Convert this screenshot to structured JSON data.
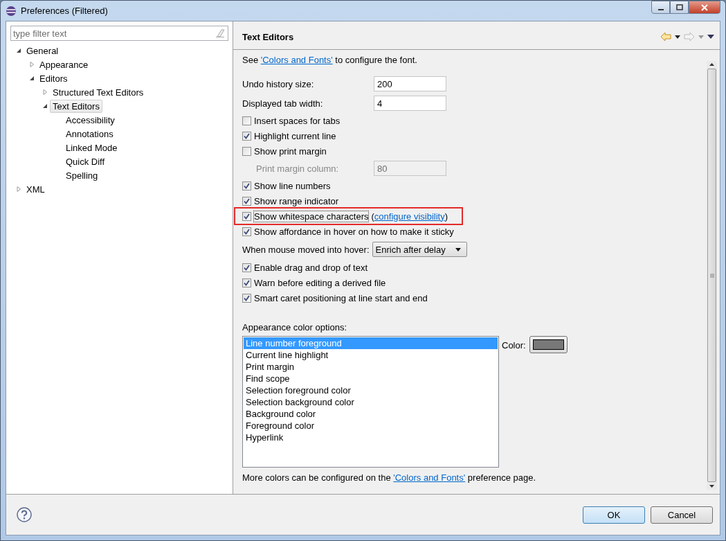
{
  "window": {
    "title": "Preferences (Filtered)"
  },
  "sidebar": {
    "filter": {
      "placeholder": "type filter text"
    },
    "tree": [
      {
        "label": "General",
        "expanded": true,
        "selected": false,
        "children": [
          {
            "label": "Appearance",
            "expanded": false,
            "selected": false,
            "has_children": true
          },
          {
            "label": "Editors",
            "expanded": true,
            "selected": false,
            "children": [
              {
                "label": "Structured Text Editors",
                "expanded": false,
                "selected": false,
                "has_children": true
              },
              {
                "label": "Text Editors",
                "expanded": true,
                "selected": true,
                "children": [
                  {
                    "label": "Accessibility",
                    "selected": false
                  },
                  {
                    "label": "Annotations",
                    "selected": false
                  },
                  {
                    "label": "Linked Mode",
                    "selected": false
                  },
                  {
                    "label": "Quick Diff",
                    "selected": false
                  },
                  {
                    "label": "Spelling",
                    "selected": false
                  }
                ]
              }
            ]
          }
        ]
      },
      {
        "label": "XML",
        "expanded": false,
        "selected": false,
        "has_children": true
      }
    ]
  },
  "page": {
    "title": "Text Editors",
    "intro": {
      "before": "See ",
      "link": "'Colors and Fonts'",
      "after": " to configure the font."
    },
    "settings": [
      {
        "kind": "field",
        "label": "Undo history size:",
        "value": "200",
        "disabled": false
      },
      {
        "kind": "field",
        "label": "Displayed tab width:",
        "value": "4",
        "disabled": false
      },
      {
        "kind": "checkbox",
        "label": "Insert spaces for tabs",
        "checked": false,
        "highlighted": false
      },
      {
        "kind": "checkbox",
        "label": "Highlight current line",
        "checked": true,
        "highlighted": false
      },
      {
        "kind": "checkbox",
        "label": "Show print margin",
        "checked": false,
        "highlighted": false
      },
      {
        "kind": "field",
        "label": "Print margin column:",
        "value": "80",
        "disabled": true
      },
      {
        "kind": "checkbox",
        "label": "Show line numbers",
        "checked": true,
        "highlighted": false
      },
      {
        "kind": "checkbox",
        "label": "Show range indicator",
        "checked": true,
        "highlighted": false
      },
      {
        "kind": "checkbox",
        "label": "Show whitespace characters",
        "checked": true,
        "highlighted": true,
        "link_open": "(",
        "link": "configure visibility",
        "link_close": ")"
      },
      {
        "kind": "checkbox",
        "label": "Show affordance in hover on how to make it sticky",
        "checked": true,
        "highlighted": false
      },
      {
        "kind": "dropdown",
        "label": "When mouse moved into hover:",
        "value": "Enrich after delay"
      },
      {
        "kind": "checkbox",
        "label": "Enable drag and drop of text",
        "checked": true,
        "highlighted": false
      },
      {
        "kind": "checkbox",
        "label": "Warn before editing a derived file",
        "checked": true,
        "highlighted": false
      },
      {
        "kind": "checkbox",
        "label": "Smart caret positioning at line start and end",
        "checked": true,
        "highlighted": false
      }
    ],
    "color_options": {
      "label": "Appearance color options:",
      "items": [
        {
          "label": "Line number foreground",
          "selected": true
        },
        {
          "label": "Current line highlight",
          "selected": false
        },
        {
          "label": "Print margin",
          "selected": false
        },
        {
          "label": "Find scope",
          "selected": false
        },
        {
          "label": "Selection foreground color",
          "selected": false
        },
        {
          "label": "Selection background color",
          "selected": false
        },
        {
          "label": "Background color",
          "selected": false
        },
        {
          "label": "Foreground color",
          "selected": false
        },
        {
          "label": "Hyperlink",
          "selected": false
        }
      ],
      "color_label": "Color:",
      "color": "#787878"
    },
    "footer": {
      "before": "More colors can be configured on the ",
      "link": "'Colors and Fonts'",
      "after": " preference page."
    }
  },
  "buttons": [
    {
      "label": "OK",
      "default": true
    },
    {
      "label": "Cancel",
      "default": false
    }
  ]
}
